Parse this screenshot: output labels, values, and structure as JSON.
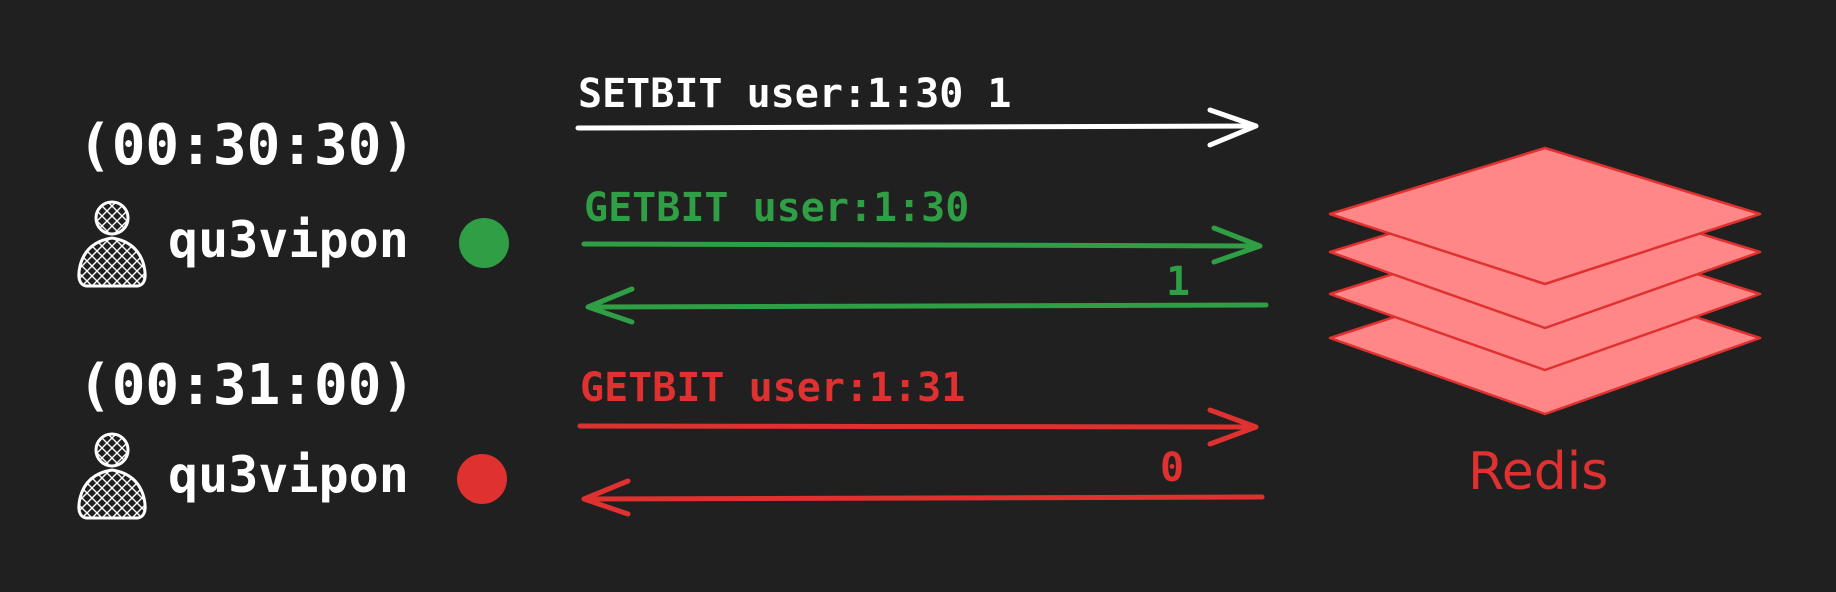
{
  "colors": {
    "background": "#202020",
    "white": "#ffffff",
    "green": "#2f9e44",
    "red": "#e03131",
    "redis_fill": "#ff8787"
  },
  "sessions": [
    {
      "time": "(00:30:30)",
      "user": "qu3vipon",
      "status": "green",
      "set_command": "SETBIT user:1:30 1",
      "get_command": "GETBIT user:1:30",
      "response": "1"
    },
    {
      "time": "(00:31:00)",
      "user": "qu3vipon",
      "status": "red",
      "get_command": "GETBIT user:1:31",
      "response": "0"
    }
  ],
  "server": {
    "label": "Redis",
    "icon": "stacked-layers-icon"
  },
  "user_icon": "user-icon"
}
